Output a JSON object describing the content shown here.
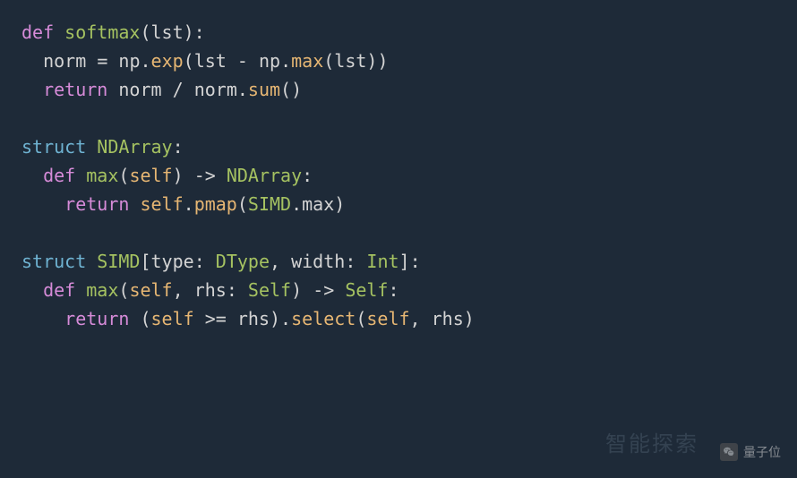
{
  "code": {
    "lines": [
      {
        "indent": 0,
        "tokens": [
          {
            "cls": "kw-def",
            "t": "def"
          },
          {
            "cls": "punct",
            "t": " "
          },
          {
            "cls": "fn-name",
            "t": "softmax"
          },
          {
            "cls": "punct",
            "t": "("
          },
          {
            "cls": "param",
            "t": "lst"
          },
          {
            "cls": "punct",
            "t": "):"
          }
        ]
      },
      {
        "indent": 1,
        "tokens": [
          {
            "cls": "ident",
            "t": "norm "
          },
          {
            "cls": "op",
            "t": "= "
          },
          {
            "cls": "ident",
            "t": "np"
          },
          {
            "cls": "punct",
            "t": "."
          },
          {
            "cls": "method",
            "t": "exp"
          },
          {
            "cls": "punct",
            "t": "("
          },
          {
            "cls": "ident",
            "t": "lst "
          },
          {
            "cls": "op",
            "t": "- "
          },
          {
            "cls": "ident",
            "t": "np"
          },
          {
            "cls": "punct",
            "t": "."
          },
          {
            "cls": "method",
            "t": "max"
          },
          {
            "cls": "punct",
            "t": "("
          },
          {
            "cls": "ident",
            "t": "lst"
          },
          {
            "cls": "punct",
            "t": "))"
          }
        ]
      },
      {
        "indent": 1,
        "tokens": [
          {
            "cls": "kw-return",
            "t": "return"
          },
          {
            "cls": "punct",
            "t": " "
          },
          {
            "cls": "ident",
            "t": "norm "
          },
          {
            "cls": "op",
            "t": "/ "
          },
          {
            "cls": "ident",
            "t": "norm"
          },
          {
            "cls": "punct",
            "t": "."
          },
          {
            "cls": "method",
            "t": "sum"
          },
          {
            "cls": "punct",
            "t": "()"
          }
        ]
      },
      {
        "indent": 0,
        "tokens": []
      },
      {
        "indent": 0,
        "tokens": [
          {
            "cls": "kw-struct",
            "t": "struct"
          },
          {
            "cls": "punct",
            "t": " "
          },
          {
            "cls": "type-name",
            "t": "NDArray"
          },
          {
            "cls": "punct",
            "t": ":"
          }
        ]
      },
      {
        "indent": 1,
        "tokens": [
          {
            "cls": "kw-def",
            "t": "def"
          },
          {
            "cls": "punct",
            "t": " "
          },
          {
            "cls": "fn-name",
            "t": "max"
          },
          {
            "cls": "punct",
            "t": "("
          },
          {
            "cls": "self-kw",
            "t": "self"
          },
          {
            "cls": "punct",
            "t": ") "
          },
          {
            "cls": "op",
            "t": "-> "
          },
          {
            "cls": "type-name",
            "t": "NDArray"
          },
          {
            "cls": "punct",
            "t": ":"
          }
        ]
      },
      {
        "indent": 2,
        "tokens": [
          {
            "cls": "kw-return",
            "t": "return"
          },
          {
            "cls": "punct",
            "t": " "
          },
          {
            "cls": "self-kw",
            "t": "self"
          },
          {
            "cls": "punct",
            "t": "."
          },
          {
            "cls": "method",
            "t": "pmap"
          },
          {
            "cls": "punct",
            "t": "("
          },
          {
            "cls": "type-name",
            "t": "SIMD"
          },
          {
            "cls": "punct",
            "t": "."
          },
          {
            "cls": "ident",
            "t": "max"
          },
          {
            "cls": "punct",
            "t": ")"
          }
        ]
      },
      {
        "indent": 0,
        "tokens": []
      },
      {
        "indent": 0,
        "tokens": [
          {
            "cls": "kw-struct",
            "t": "struct"
          },
          {
            "cls": "punct",
            "t": " "
          },
          {
            "cls": "type-name",
            "t": "SIMD"
          },
          {
            "cls": "punct",
            "t": "["
          },
          {
            "cls": "ident",
            "t": "type"
          },
          {
            "cls": "punct",
            "t": ": "
          },
          {
            "cls": "type-name",
            "t": "DType"
          },
          {
            "cls": "punct",
            "t": ", "
          },
          {
            "cls": "ident",
            "t": "width"
          },
          {
            "cls": "punct",
            "t": ": "
          },
          {
            "cls": "type-name",
            "t": "Int"
          },
          {
            "cls": "punct",
            "t": "]:"
          }
        ]
      },
      {
        "indent": 1,
        "tokens": [
          {
            "cls": "kw-def",
            "t": "def"
          },
          {
            "cls": "punct",
            "t": " "
          },
          {
            "cls": "fn-name",
            "t": "max"
          },
          {
            "cls": "punct",
            "t": "("
          },
          {
            "cls": "self-kw",
            "t": "self"
          },
          {
            "cls": "punct",
            "t": ", "
          },
          {
            "cls": "ident",
            "t": "rhs"
          },
          {
            "cls": "punct",
            "t": ": "
          },
          {
            "cls": "type-name",
            "t": "Self"
          },
          {
            "cls": "punct",
            "t": ") "
          },
          {
            "cls": "op",
            "t": "-> "
          },
          {
            "cls": "type-name",
            "t": "Self"
          },
          {
            "cls": "punct",
            "t": ":"
          }
        ]
      },
      {
        "indent": 2,
        "tokens": [
          {
            "cls": "kw-return",
            "t": "return"
          },
          {
            "cls": "punct",
            "t": " "
          },
          {
            "cls": "punct",
            "t": "("
          },
          {
            "cls": "self-kw",
            "t": "self"
          },
          {
            "cls": "punct",
            "t": " "
          },
          {
            "cls": "op",
            "t": ">= "
          },
          {
            "cls": "ident",
            "t": "rhs"
          },
          {
            "cls": "punct",
            "t": ")."
          },
          {
            "cls": "method",
            "t": "select"
          },
          {
            "cls": "punct",
            "t": "("
          },
          {
            "cls": "self-kw",
            "t": "self"
          },
          {
            "cls": "punct",
            "t": ", "
          },
          {
            "cls": "ident",
            "t": "rhs"
          },
          {
            "cls": "punct",
            "t": ")"
          }
        ]
      }
    ],
    "indent_unit": "  "
  },
  "watermark": {
    "text": "量子位",
    "faint": "智能探索"
  }
}
